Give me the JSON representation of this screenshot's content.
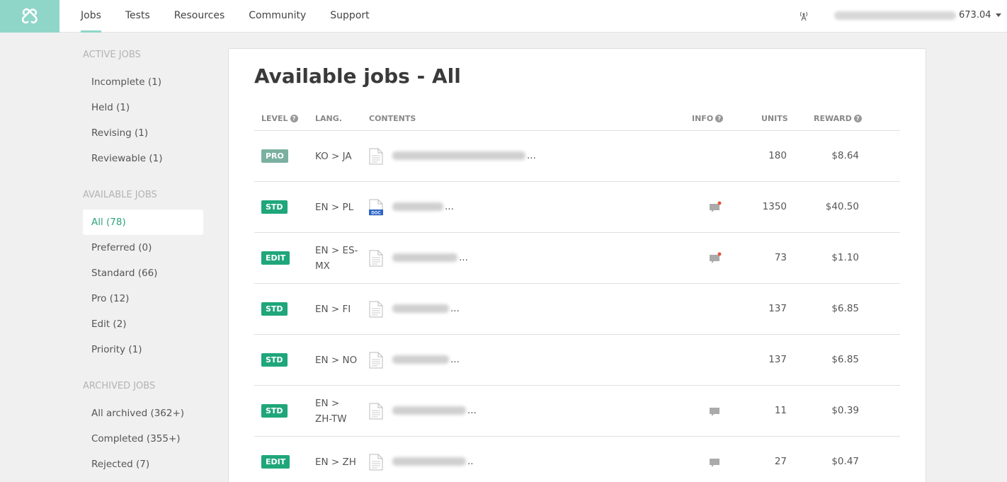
{
  "nav": {
    "items": [
      {
        "label": "Jobs",
        "active": true
      },
      {
        "label": "Tests",
        "active": false
      },
      {
        "label": "Resources",
        "active": false
      },
      {
        "label": "Community",
        "active": false
      },
      {
        "label": "Support",
        "active": false
      }
    ]
  },
  "user": {
    "balance": "673.04"
  },
  "sidebar": {
    "active_heading": "ACTIVE JOBS",
    "active_items": [
      "Incomplete (1)",
      "Held (1)",
      "Revising (1)",
      "Reviewable (1)"
    ],
    "available_heading": "AVAILABLE JOBS",
    "available_items": [
      "All (78)",
      "Preferred (0)",
      "Standard (66)",
      "Pro (12)",
      "Edit (2)",
      "Priority (1)"
    ],
    "archived_heading": "ARCHIVED JOBS",
    "archived_items": [
      "All archived (362+)",
      "Completed (355+)",
      "Rejected (7)"
    ]
  },
  "page": {
    "title": "Available jobs - All"
  },
  "table": {
    "headers": {
      "level": "LEVEL",
      "lang": "LANG.",
      "contents": "CONTENTS",
      "info": "INFO",
      "units": "UNITS",
      "reward": "REWARD"
    },
    "rows": [
      {
        "level": "PRO",
        "lang": "KO > JA",
        "units": "180",
        "reward": "$8.64",
        "doc_icon": "text-doc-icon",
        "info_icon": "",
        "content_suffix": "..."
      },
      {
        "level": "STD",
        "lang": "EN > PL",
        "units": "1350",
        "reward": "$40.50",
        "doc_icon": "word-doc-icon",
        "info_icon": "comment-new-icon",
        "content_suffix": "..."
      },
      {
        "level": "EDIT",
        "lang": "EN > ES-MX",
        "units": "73",
        "reward": "$1.10",
        "doc_icon": "text-doc-icon",
        "info_icon": "comment-new-icon",
        "content_suffix": "..."
      },
      {
        "level": "STD",
        "lang": "EN > FI",
        "units": "137",
        "reward": "$6.85",
        "doc_icon": "text-doc-icon",
        "info_icon": "",
        "content_suffix": "..."
      },
      {
        "level": "STD",
        "lang": "EN > NO",
        "units": "137",
        "reward": "$6.85",
        "doc_icon": "text-doc-icon",
        "info_icon": "",
        "content_suffix": "..."
      },
      {
        "level": "STD",
        "lang": "EN > ZH-TW",
        "units": "11",
        "reward": "$0.39",
        "doc_icon": "text-doc-icon",
        "info_icon": "comment-icon",
        "content_suffix": "..."
      },
      {
        "level": "EDIT",
        "lang": "EN > ZH",
        "units": "27",
        "reward": "$0.47",
        "doc_icon": "text-doc-icon",
        "info_icon": "comment-icon",
        "content_suffix": ".."
      }
    ]
  },
  "colors": {
    "accent": "#8fd6c8",
    "green": "#1fa67a",
    "pro": "#7bb0a0",
    "notify": "#e0553b"
  }
}
